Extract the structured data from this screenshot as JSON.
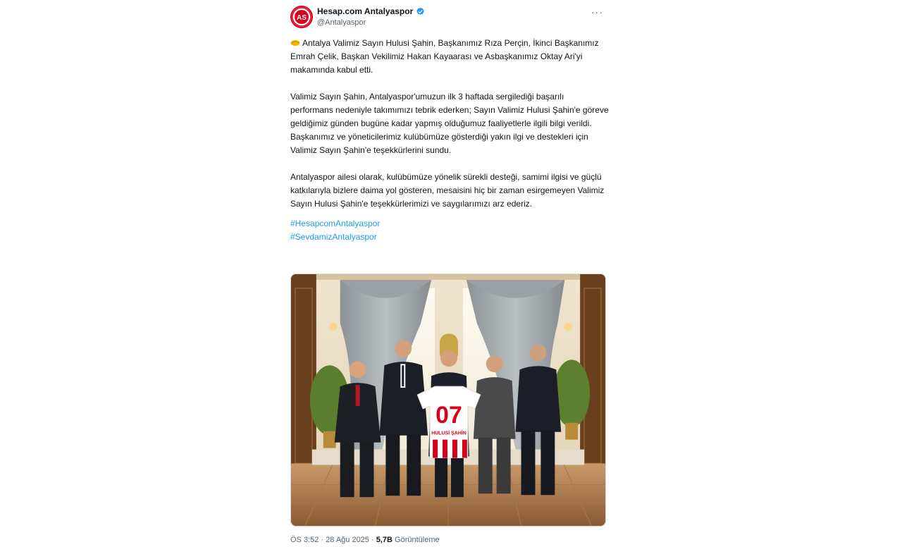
{
  "account": {
    "display_name": "Hesap.com Antalyaspor",
    "handle": "@Antalyaspor",
    "verified": true
  },
  "post": {
    "paragraphs": [
      "Antalya Valimiz Sayın Hulusi Şahin, Başkanımız Rıza Perçin, İkinci Başkanımız Emrah Çelik, Başkan Vekilimiz Hakan Kayaarası ve Asbaşkanımız Oktay Ari'yi makamında kabul etti.",
      "Valimiz Sayın Şahin, Antalyaspor'umuzun ilk 3 haftada sergilediği başarılı performans nedeniyle takımımızı tebrik ederken; Sayın Valimiz Hulusi Şahin'e göreve geldiğimiz günden bugüne kadar yapmış olduğumuz faaliyetlerle ilgili bilgi verildi. Başkanımız ve yöneticilerimiz kulübümüze gösterdiği yakın ilgi ve destekleri için Valimiz Sayın Şahin'e teşekkürlerini sundu.",
      "Antalyaspor ailesi olarak, kulübümüze yönelik sürekli desteği, samimi ilgisi ve güçlü katkılarıyla bizlere daima yol gösteren, mesaisini hiç bir zaman esirgemeyen Valimiz Sayın Hulusi Şahin'e teşekkürlerimizi ve saygılarımızı arz ederiz."
    ],
    "hashtags": [
      "#HesapcomAntalyaspor",
      "#SevdamizAntalyaspor"
    ],
    "photo": {
      "jersey_number": "07",
      "jersey_name": "HULUSİ ŞAHİN"
    }
  },
  "footer": {
    "time": "ÖS 3:52 · 28 Ağu 2025 ·",
    "views_count": "5,7B",
    "views_label": "Görüntüleme"
  },
  "colors": {
    "brand_red": "#d6001c",
    "link_blue": "#1d9bf0",
    "secondary_text": "#536471"
  },
  "icons": {
    "avatar": "antalyaspor-logo-icon",
    "verified": "verified-badge-icon",
    "more": "more-options-icon",
    "emoji": "handshake-emoji-icon"
  }
}
